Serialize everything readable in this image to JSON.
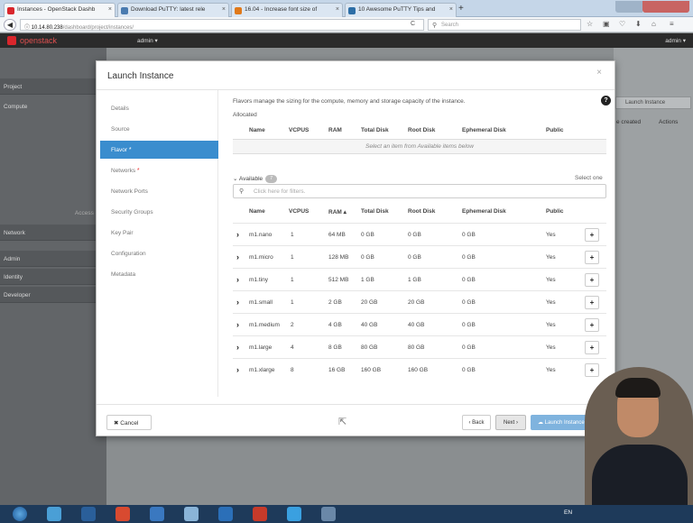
{
  "browser": {
    "tabs": [
      {
        "title": "Instances - OpenStack Dashb",
        "color": "#d9262c"
      },
      {
        "title": "Download PuTTY: latest rele",
        "color": "#4a7bb0"
      },
      {
        "title": "16.04 - Increase font size of",
        "color": "#e0791a"
      },
      {
        "title": "10 Awesome PuTTY Tips and",
        "color": "#2d6ea6"
      }
    ],
    "new_tab": "+",
    "url_host": "10.14.80.238",
    "url_path": "/dashboard/project/instances/",
    "search_placeholder": "Search"
  },
  "openstack": {
    "brand": "openstack",
    "project_selector": "admin ▾",
    "user": "admin ▾"
  },
  "sidebar": {
    "project": "Project",
    "compute": "Compute",
    "access": "Access &",
    "network": "Network",
    "admin": "Admin",
    "identity": "Identity",
    "developer": "Developer"
  },
  "background": {
    "launch_button": "Launch Instance",
    "col_created": "e created",
    "col_actions": "Actions"
  },
  "modal": {
    "title": "Launch Instance",
    "close": "×",
    "steps": [
      {
        "label": "Details",
        "required": false
      },
      {
        "label": "Source",
        "required": false
      },
      {
        "label": "Flavor",
        "required": true
      },
      {
        "label": "Networks",
        "required": true
      },
      {
        "label": "Network Ports",
        "required": false
      },
      {
        "label": "Security Groups",
        "required": false
      },
      {
        "label": "Key Pair",
        "required": false
      },
      {
        "label": "Configuration",
        "required": false
      },
      {
        "label": "Metadata",
        "required": false
      }
    ],
    "help": "?",
    "description": "Flavors manage the sizing for the compute, memory and storage capacity of the instance.",
    "allocated_label": "Allocated",
    "allocated_columns": [
      "Name",
      "VCPUS",
      "RAM",
      "Total Disk",
      "Root Disk",
      "Ephemeral Disk",
      "Public"
    ],
    "allocated_empty": "Select an item from Available items below",
    "available_label": "Available",
    "available_count": "7",
    "select_one": "Select one",
    "filter_placeholder": "Click here for filters.",
    "available_columns": [
      "Name",
      "VCPUS",
      "RAM ▴",
      "Total Disk",
      "Root Disk",
      "Ephemeral Disk",
      "Public"
    ],
    "flavors": [
      {
        "name": "m1.nano",
        "vcpus": "1",
        "ram": "64 MB",
        "total_disk": "0 GB",
        "root_disk": "0 GB",
        "ephemeral": "0 GB",
        "public": "Yes"
      },
      {
        "name": "m1.micro",
        "vcpus": "1",
        "ram": "128 MB",
        "total_disk": "0 GB",
        "root_disk": "0 GB",
        "ephemeral": "0 GB",
        "public": "Yes"
      },
      {
        "name": "m1.tiny",
        "vcpus": "1",
        "ram": "512 MB",
        "total_disk": "1 GB",
        "root_disk": "1 GB",
        "ephemeral": "0 GB",
        "public": "Yes"
      },
      {
        "name": "m1.small",
        "vcpus": "1",
        "ram": "2 GB",
        "total_disk": "20 GB",
        "root_disk": "20 GB",
        "ephemeral": "0 GB",
        "public": "Yes"
      },
      {
        "name": "m1.medium",
        "vcpus": "2",
        "ram": "4 GB",
        "total_disk": "40 GB",
        "root_disk": "40 GB",
        "ephemeral": "0 GB",
        "public": "Yes"
      },
      {
        "name": "m1.large",
        "vcpus": "4",
        "ram": "8 GB",
        "total_disk": "80 GB",
        "root_disk": "80 GB",
        "ephemeral": "0 GB",
        "public": "Yes"
      },
      {
        "name": "m1.xlarge",
        "vcpus": "8",
        "ram": "16 GB",
        "total_disk": "160 GB",
        "root_disk": "160 GB",
        "ephemeral": "0 GB",
        "public": "Yes"
      }
    ],
    "add_label": "+",
    "cancel": "✖ Cancel",
    "back": "‹ Back",
    "next": "Next ›",
    "launch": "☁ Launch Instance"
  },
  "taskbar": {
    "tray": "EN"
  }
}
